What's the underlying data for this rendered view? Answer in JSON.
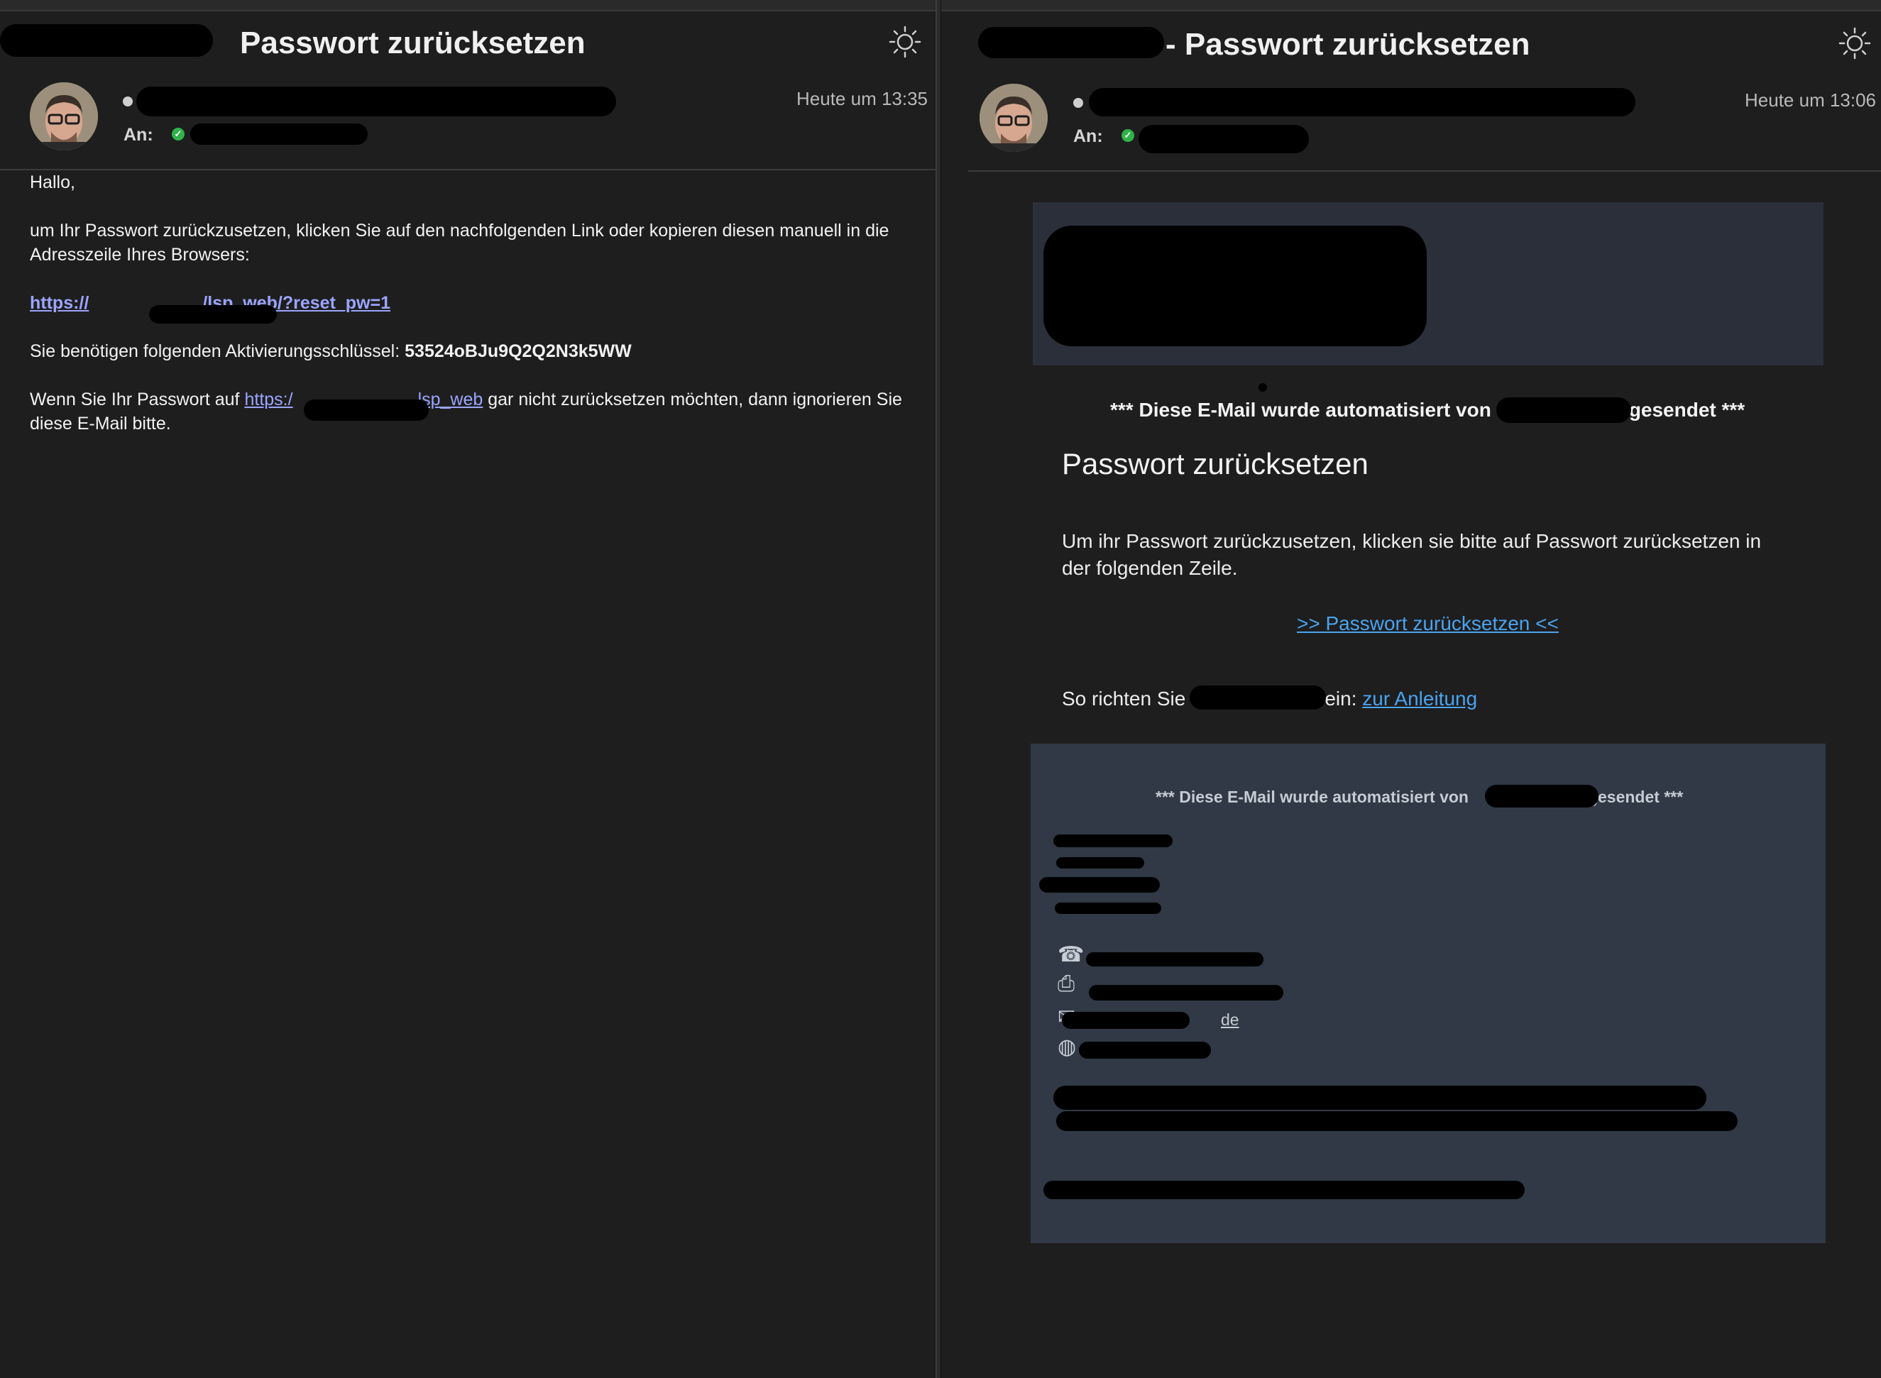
{
  "left": {
    "subject": "Passwort zurücksetzen",
    "timestamp": "Heute um 13:35",
    "to_label": "An:",
    "body": {
      "greeting": "Hallo,",
      "intro": "um Ihr Passwort zurückzusetzen, klicken Sie auf den nachfolgenden Link oder kopieren diesen manuell in die Adresszeile Ihres Browsers:",
      "reset_link_prefix": "https://",
      "reset_link_suffix": "/lsp_web/?reset_pw=1",
      "key_label": "Sie benötigen folgenden Aktivierungsschlüssel:",
      "key_value": "53524oBJu9Q2Q2N3k5WW",
      "ignore_pre": "Wenn Sie Ihr Passwort auf",
      "ignore_link_prefix": "https:/",
      "ignore_link_suffix": "lsp_web",
      "ignore_post": "gar nicht zurücksetzen möchten, dann ignorieren Sie diese E-Mail bitte."
    }
  },
  "right": {
    "subject": "- Passwort zurücksetzen",
    "timestamp": "Heute um 13:06",
    "to_label": "An:",
    "notice_pre": "*** Diese E-Mail wurde automatisiert von",
    "notice_post": "gesendet ***",
    "title": "Passwort zurücksetzen",
    "instructions": "Um ihr Passwort zurückzusetzen, klicken sie bitte auf Passwort zurücksetzen in der folgenden Zeile.",
    "reset_link": ">> Passwort zurücksetzen <<",
    "setup_pre": "So richten Sie",
    "setup_mid": "ein:",
    "setup_link": "zur Anleitung",
    "footer": {
      "notice_pre": "*** Diese E-Mail wurde automatisiert von",
      "notice_post": "gesendet ***",
      "email_suffix": "de",
      "phone_icon": "phone-icon",
      "fax_icon": "fax-icon",
      "mail_icon": "mail-icon",
      "web_icon": "globe-icon"
    }
  },
  "colors": {
    "background": "#1e1e1e",
    "link_left": "#9ca4ff",
    "link_right": "#4aa3f0",
    "footer_bg": "#303945",
    "banner_bg": "#2b2f3a",
    "verified": "#2fb34a"
  }
}
